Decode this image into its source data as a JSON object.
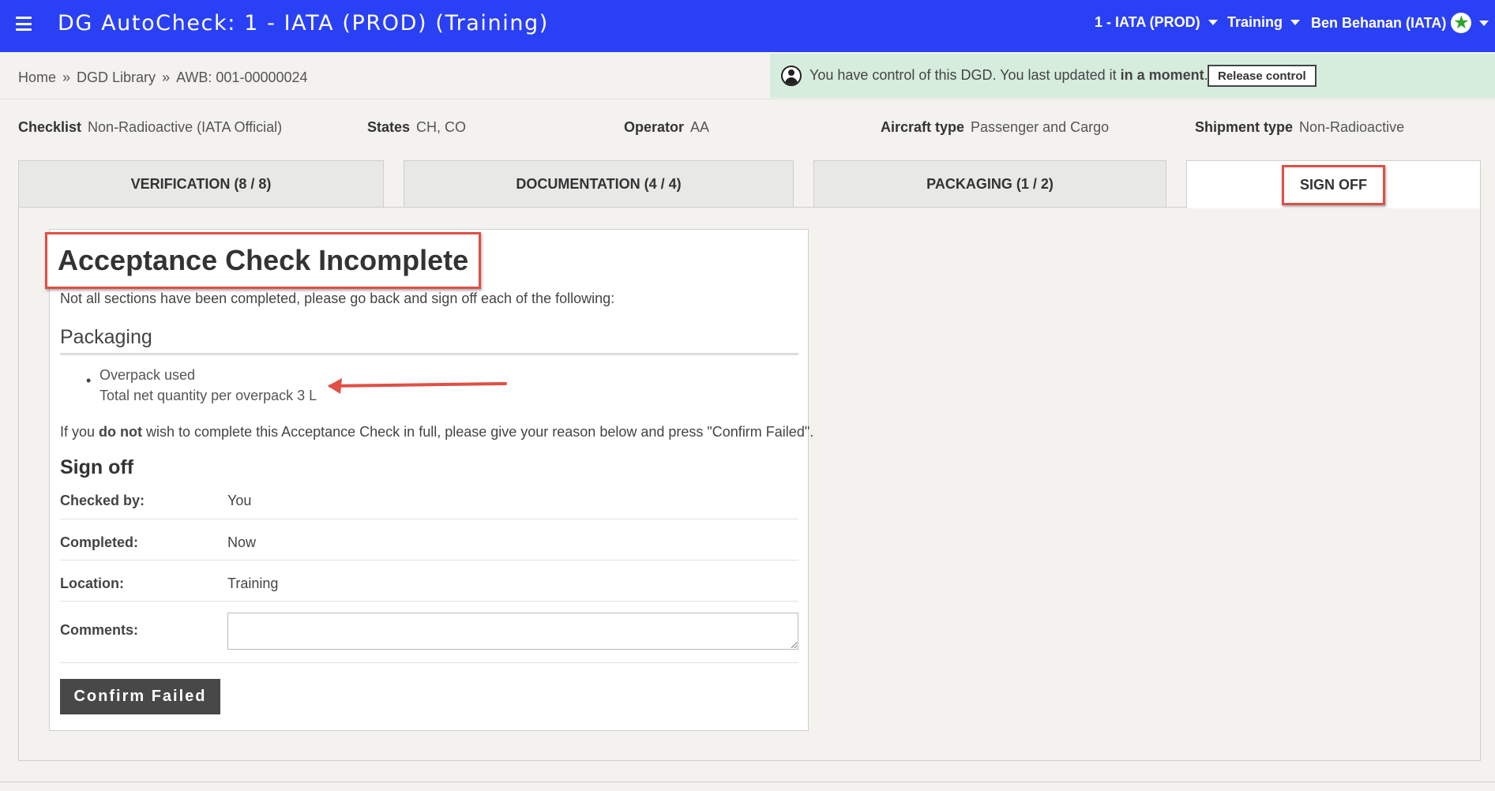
{
  "app": {
    "title": "DG AutoCheck: 1 - IATA (PROD) (Training)",
    "menu_org": "1 - IATA (PROD)",
    "menu_location": "Training",
    "menu_user": "Ben Behanan (IATA)",
    "colors": {
      "topbar": "#2a40f5",
      "banner": "#d6ecdd",
      "highlight": "#e04f45"
    }
  },
  "breadcrumb": {
    "home": "Home",
    "library": "DGD Library",
    "current": "AWB: 001-00000024",
    "separator": "»"
  },
  "control_banner": {
    "text_before": "You have control of this DGD. You last updated it ",
    "text_bold": "in a moment",
    "text_after": ".",
    "release_label": "Release control"
  },
  "info": {
    "checklist_label": "Checklist",
    "checklist_value": "Non-Radioactive (IATA Official)",
    "states_label": "States",
    "states_value": "CH, CO",
    "operator_label": "Operator",
    "operator_value": "AA",
    "aircraft_label": "Aircraft type",
    "aircraft_value": "Passenger and Cargo",
    "shipment_label": "Shipment type",
    "shipment_value": "Non-Radioactive"
  },
  "tabs": [
    {
      "label": "VERIFICATION (8 / 8)"
    },
    {
      "label": "DOCUMENTATION (4 / 4)"
    },
    {
      "label": "PACKAGING (1 / 2)"
    },
    {
      "label": "SIGN OFF"
    }
  ],
  "card": {
    "title": "Acceptance Check Incomplete",
    "intro": "Not all sections have been completed, please go back and sign off each of the following:",
    "section_heading": "Packaging",
    "item_line1": "Overpack used",
    "item_line2": "Total net quantity per overpack 3 L",
    "notice_before": "If you ",
    "notice_bold": "do not",
    "notice_after": " wish to complete this Acceptance Check in full, please give your reason below and press \"Confirm Failed\".",
    "signoff_heading": "Sign off",
    "checked_by_label": "Checked by:",
    "checked_by_value": "You",
    "completed_label": "Completed:",
    "completed_value": "Now",
    "location_label": "Location:",
    "location_value": "Training",
    "comments_label": "Comments:",
    "comments_value": "",
    "confirm_label": "Confirm Failed"
  }
}
